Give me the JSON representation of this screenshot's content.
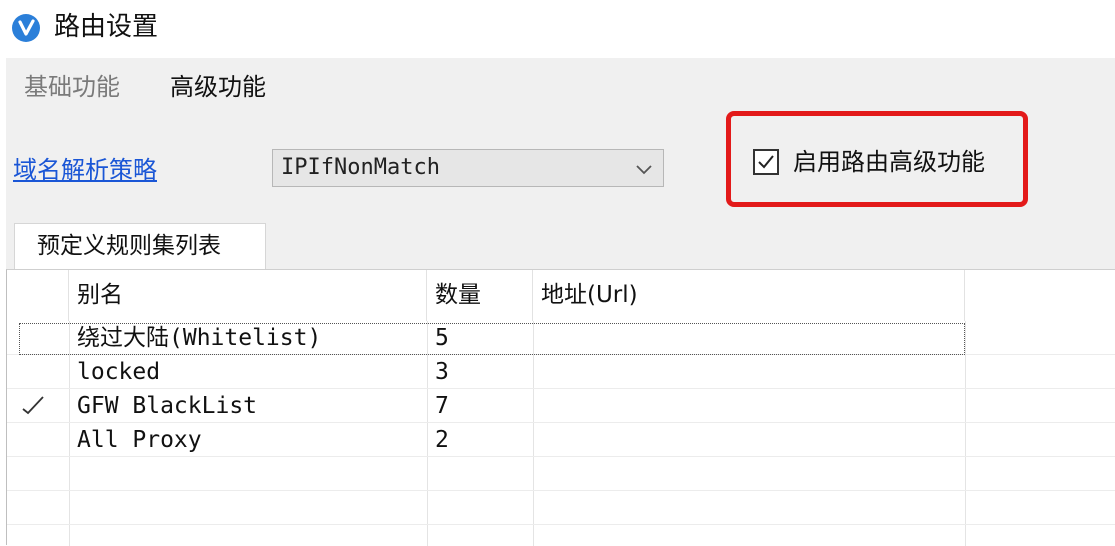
{
  "window": {
    "title": "路由设置"
  },
  "tabs": [
    {
      "label": "基础功能",
      "active": false
    },
    {
      "label": "高级功能",
      "active": true
    }
  ],
  "dns_strategy": {
    "label": "域名解析策略",
    "value": "IPIfNonMatch"
  },
  "advanced_toggle": {
    "label": "启用路由高级功能",
    "checked": true
  },
  "rules_tab": {
    "label": "预定义规则集列表"
  },
  "table": {
    "headers": [
      "别名",
      "数量",
      "地址(Url)"
    ],
    "rows": [
      {
        "mark": "",
        "alias": "绕过大陆(Whitelist)",
        "count": "5",
        "url": ""
      },
      {
        "mark": "",
        "alias": "locked",
        "count": "3",
        "url": ""
      },
      {
        "mark": "check",
        "alias": "GFW BlackList",
        "count": "7",
        "url": ""
      },
      {
        "mark": "",
        "alias": "All Proxy",
        "count": "2",
        "url": ""
      }
    ]
  },
  "colors": {
    "accent": "#2b7fd9",
    "link": "#1a56d6",
    "highlight_border": "#e31a1a",
    "panel_bg": "#f0f0f0"
  },
  "icons": {
    "logo": "v-logo-icon",
    "dropdown": "chevron-down-icon",
    "checkbox": "checkmark-icon",
    "row_selected": "checkmark-icon"
  }
}
